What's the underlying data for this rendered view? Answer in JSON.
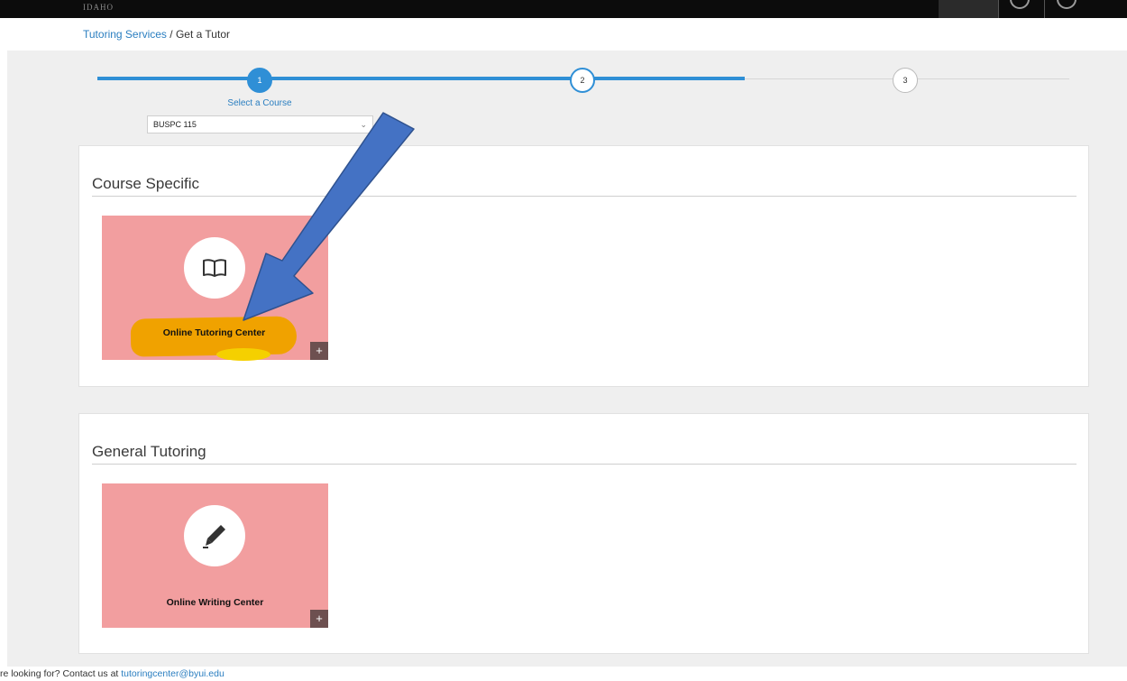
{
  "header": {
    "logo_text": "IDAHO"
  },
  "breadcrumb": {
    "parent": "Tutoring Services",
    "separator": " / ",
    "current": "Get a Tutor"
  },
  "stepper": {
    "steps": [
      "1",
      "2",
      "3"
    ],
    "active_label": "Select a Course",
    "course_select_value": "BUSPC 115"
  },
  "sections": [
    {
      "title": "Course Specific",
      "cards": [
        {
          "label": "Online Tutoring Center",
          "icon": "book-icon",
          "action": "+"
        }
      ]
    },
    {
      "title": "General Tutoring",
      "cards": [
        {
          "label": "Online Writing Center",
          "icon": "pen-icon",
          "action": "+"
        }
      ]
    }
  ],
  "footer": {
    "text": "re looking for? Contact us at ",
    "email": "tutoringcenter@byui.edu"
  },
  "colors": {
    "card_bg": "#f29e9f",
    "accent_blue": "#2f8fd6",
    "highlight": "#f0a200",
    "arrow": "#4472c4"
  }
}
